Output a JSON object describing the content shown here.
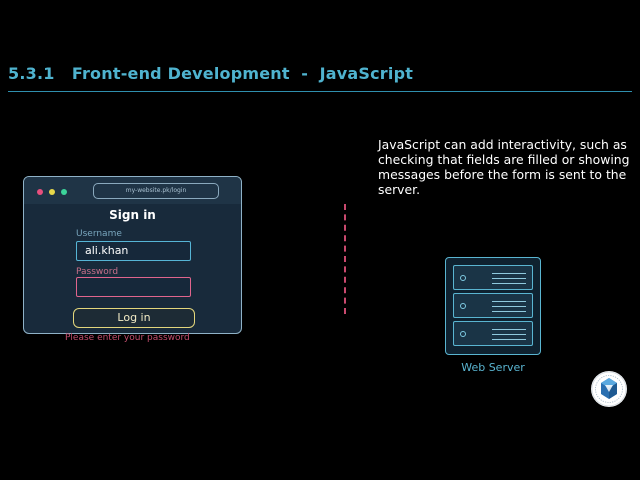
{
  "slide": {
    "title": "5.3.1   Front-end Development  -  JavaScript",
    "description": "JavaScript can add interactivity, such as checking that fields are filled or showing messages before the form is sent to the server."
  },
  "browser": {
    "url": "my-website.pk/login",
    "heading": "Sign in",
    "username_label": "Username",
    "username_value": "ali.khan",
    "password_label": "Password",
    "password_value": "",
    "login_label": "Log in",
    "error_message": "Please enter your password"
  },
  "server": {
    "label": "Web Server"
  },
  "colors": {
    "accent": "#4fb3cf",
    "error": "#c24e6d",
    "button_border": "#e3d67c"
  },
  "icons": [
    "window-dot-red",
    "window-dot-yellow",
    "window-dot-green",
    "server-icon",
    "institution-logo"
  ]
}
